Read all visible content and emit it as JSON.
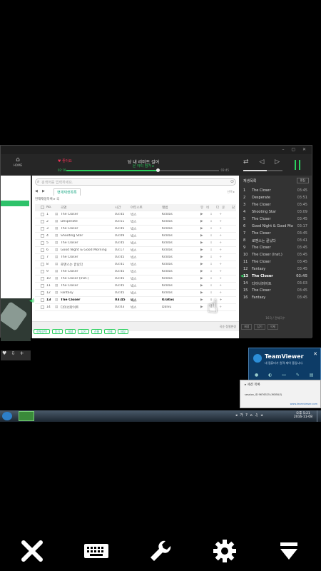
{
  "player": {
    "home_label": "HOME",
    "like_label": "♥ 좋아요",
    "song_title": "당 내 리미트 걸어",
    "song_sub": "은 아티 참가 ▸",
    "time_current": "02:18",
    "time_total": "03:45",
    "progress": 0.6
  },
  "search": {
    "placeholder": "검색어를 입력하세요."
  },
  "tabs": {
    "active": "현재재생목록",
    "right_label": "선택 ▸"
  },
  "breadcrumb": "현재재생목록 ▸ 곡",
  "table": {
    "headers": [
      "No.",
      "곡명",
      "시간",
      "아티스트",
      "앨범",
      "뮤비",
      "다운",
      "담기"
    ],
    "rows": [
      {
        "no": "1",
        "title": "The Closer",
        "time": "03:45",
        "artist": "빅스",
        "album": "Kratos"
      },
      {
        "no": "2",
        "title": "Desperate",
        "time": "03:51",
        "artist": "빅스",
        "album": "Kratos"
      },
      {
        "no": "3",
        "title": "The Closer",
        "time": "03:45",
        "artist": "빅스",
        "album": "Kratos"
      },
      {
        "no": "4",
        "title": "Shooting Star",
        "time": "03:09",
        "artist": "빅스",
        "album": "Kratos"
      },
      {
        "no": "5",
        "title": "The Closer",
        "time": "03:45",
        "artist": "빅스",
        "album": "Kratos"
      },
      {
        "no": "6",
        "title": "Good Night & Good Morning",
        "time": "03:17",
        "artist": "빅스",
        "album": "Kratos"
      },
      {
        "no": "7",
        "title": "The Closer",
        "time": "03:45",
        "artist": "빅스",
        "album": "Kratos"
      },
      {
        "no": "8",
        "title": "로맨스는 끝났다",
        "time": "03:41",
        "artist": "빅스",
        "album": "Kratos"
      },
      {
        "no": "9",
        "title": "The Closer",
        "time": "03:45",
        "artist": "빅스",
        "album": "Kratos"
      },
      {
        "no": "10",
        "title": "The Closer (Inst.)",
        "time": "03:45",
        "artist": "빅스",
        "album": "Kratos"
      },
      {
        "no": "11",
        "title": "The Closer",
        "time": "03:45",
        "artist": "빅스",
        "album": "Kratos"
      },
      {
        "no": "12",
        "title": "Fantasy",
        "time": "03:45",
        "artist": "빅스",
        "album": "Kratos"
      },
      {
        "no": "13",
        "title": "The Closer",
        "time": "03:45",
        "artist": "빅스",
        "album": "Kratos"
      },
      {
        "no": "14",
        "title": "다이너마이트",
        "time": "03:03",
        "artist": "빅스",
        "album": "Dalvu"
      }
    ],
    "playing_index": 12
  },
  "actions": [
    "전체선택",
    "듣기",
    "재생",
    "담기",
    "선물",
    "삭제",
    "저장"
  ],
  "actions_right": "곡순 정렬변경",
  "queue": {
    "header": "재생목록",
    "edit_label": "편집",
    "items": [
      {
        "no": "1",
        "title": "The Closer",
        "dur": "03:45"
      },
      {
        "no": "2",
        "title": "Desperate",
        "dur": "03:51"
      },
      {
        "no": "3",
        "title": "The Closer",
        "dur": "03:45"
      },
      {
        "no": "4",
        "title": "Shooting Star",
        "dur": "03:09"
      },
      {
        "no": "5",
        "title": "The Closer",
        "dur": "03:45"
      },
      {
        "no": "6",
        "title": "Good Night & Good Mor...",
        "dur": "03:17"
      },
      {
        "no": "7",
        "title": "The Closer",
        "dur": "03:45"
      },
      {
        "no": "8",
        "title": "로맨스는 끝났다",
        "dur": "03:41"
      },
      {
        "no": "9",
        "title": "The Closer",
        "dur": "03:45"
      },
      {
        "no": "10",
        "title": "The Closer (Inst.)",
        "dur": "03:45"
      },
      {
        "no": "11",
        "title": "The Closer",
        "dur": "03:45"
      },
      {
        "no": "12",
        "title": "Fantasy",
        "dur": "03:45"
      },
      {
        "no": "13",
        "title": "The Closer",
        "dur": "03:45"
      },
      {
        "no": "14",
        "title": "다이너마이트",
        "dur": "03:03"
      },
      {
        "no": "15",
        "title": "The Closer",
        "dur": "03:45"
      },
      {
        "no": "16",
        "title": "Fantasy",
        "dur": "03:45"
      }
    ],
    "playing_index": 12,
    "count": "16곡 / 전체곡수",
    "bottom": [
      "재생",
      "담기",
      "삭제"
    ]
  },
  "teamviewer": {
    "name": "TeamViewer",
    "desc": "내 컴퓨터가 원격 제어 중입니다.",
    "recent_header": "▸ 세션 목록",
    "recent_item": "session_ID 9676525 (MOBILE)",
    "link": "www.teamviewer.com"
  },
  "taskbar": {
    "clock_time": "오후 5:21",
    "clock_date": "2016-11-08",
    "tray": "◂ 가 ? ⌂ ♫ ◂"
  },
  "toolbar": {
    "close": "close-icon",
    "keyboard": "keyboard-icon",
    "tools": "wrench-icon",
    "settings": "gear-icon",
    "more": "chevron-down-icon"
  },
  "colors": {
    "accent": "#2bd05e",
    "tv_blue": "#0d3c67"
  }
}
